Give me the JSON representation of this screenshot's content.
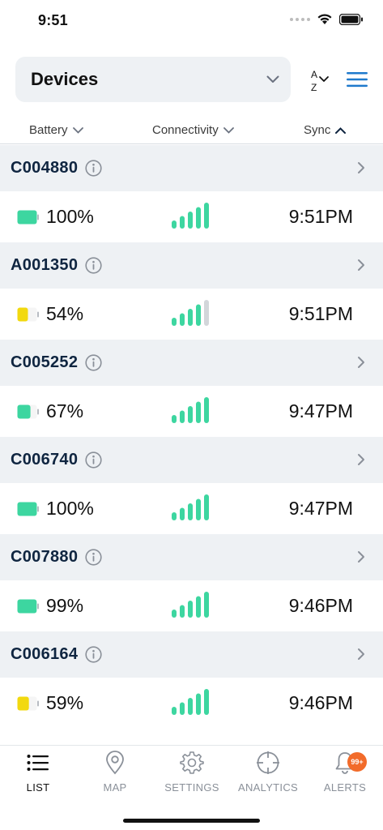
{
  "status_bar": {
    "time": "9:51"
  },
  "header": {
    "title": "Devices"
  },
  "columns": {
    "battery": "Battery",
    "connectivity": "Connectivity",
    "sync": "Sync"
  },
  "devices": [
    {
      "id": "C004880",
      "battery": "100%",
      "battery_level": 1.0,
      "battery_color": "#3dd6a0",
      "connectivity_bars": 5,
      "sync": "9:51PM"
    },
    {
      "id": "A001350",
      "battery": "54%",
      "battery_level": 0.54,
      "battery_color": "#f2d90f",
      "connectivity_bars": 4,
      "sync": "9:51PM"
    },
    {
      "id": "C005252",
      "battery": "67%",
      "battery_level": 0.67,
      "battery_color": "#3dd6a0",
      "connectivity_bars": 5,
      "sync": "9:47PM"
    },
    {
      "id": "C006740",
      "battery": "100%",
      "battery_level": 1.0,
      "battery_color": "#3dd6a0",
      "connectivity_bars": 5,
      "sync": "9:47PM"
    },
    {
      "id": "C007880",
      "battery": "99%",
      "battery_level": 0.99,
      "battery_color": "#3dd6a0",
      "connectivity_bars": 5,
      "sync": "9:46PM"
    },
    {
      "id": "C006164",
      "battery": "59%",
      "battery_level": 0.59,
      "battery_color": "#f2d90f",
      "connectivity_bars": 5,
      "sync": "9:46PM"
    }
  ],
  "tabs": [
    {
      "label": "LIST",
      "icon": "list-icon",
      "active": true
    },
    {
      "label": "MAP",
      "icon": "map-pin-icon"
    },
    {
      "label": "SETTINGS",
      "icon": "gear-icon"
    },
    {
      "label": "ANALYTICS",
      "icon": "crosshair-icon"
    },
    {
      "label": "ALERTS",
      "icon": "bell-icon",
      "badge": "99+"
    }
  ],
  "colors": {
    "accent": "#1f7acc",
    "signal_on": "#3dd6a0",
    "signal_off": "#d3d6da",
    "badge": "#f26b2a"
  }
}
